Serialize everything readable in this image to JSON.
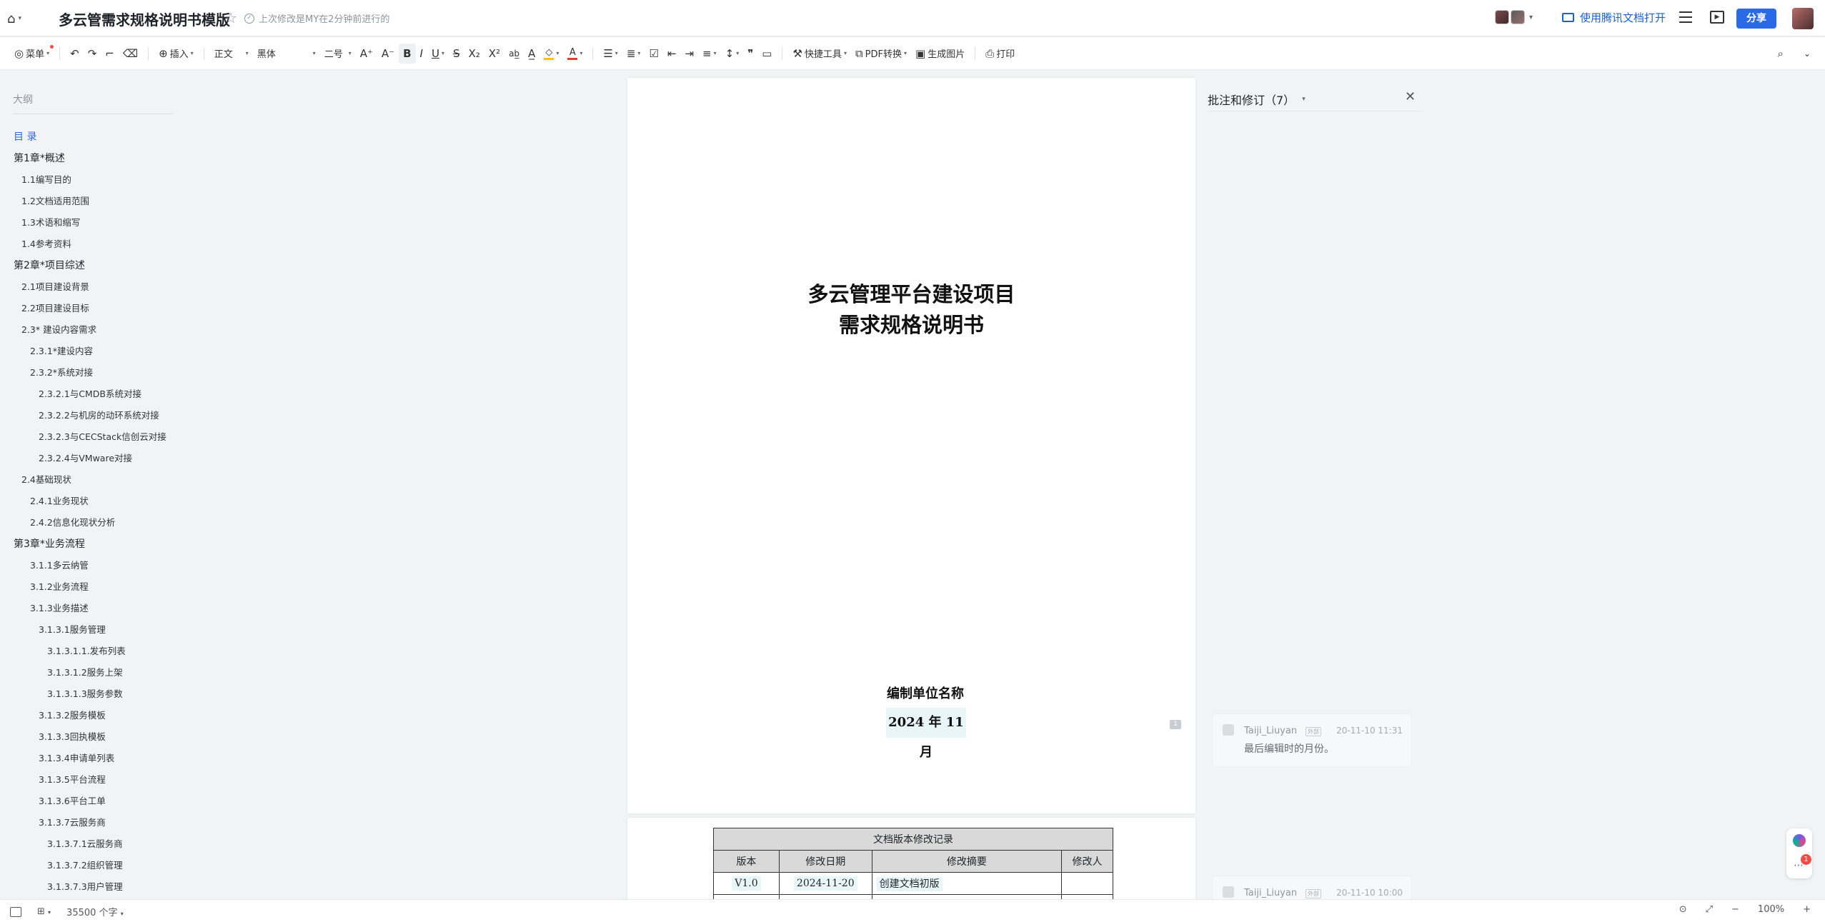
{
  "title_bar": {
    "doc_title": "多云管需求规格说明书模版",
    "last_edit": "上次修改是MY在2分钟前进行的",
    "open_app": "使用腾讯文档打开",
    "share": "分享"
  },
  "toolbar": {
    "menu": "菜单",
    "insert": "插入",
    "style": "正文",
    "font": "黑体",
    "size": "二号",
    "quick_tools": "快捷工具",
    "pdf": "PDF转换",
    "gen_image": "生成图片",
    "print": "打印",
    "font_color": "#e03e2d",
    "highlight_color": "#f7c600"
  },
  "outline": {
    "header": "大纲",
    "items": [
      {
        "text": "目 录",
        "level": 1,
        "active": true
      },
      {
        "text": "第1章*概述",
        "level": 1
      },
      {
        "text": "1.1编写目的",
        "level": 2
      },
      {
        "text": "1.2文档适用范围",
        "level": 2
      },
      {
        "text": "1.3术语和缩写",
        "level": 2
      },
      {
        "text": "1.4参考资料",
        "level": 2
      },
      {
        "text": "第2章*项目综述",
        "level": 1
      },
      {
        "text": "2.1项目建设背景",
        "level": 2
      },
      {
        "text": "2.2项目建设目标",
        "level": 2
      },
      {
        "text": "2.3*  建设内容需求",
        "level": 2
      },
      {
        "text": "2.3.1*建设内容",
        "level": 3
      },
      {
        "text": "2.3.2*系统对接",
        "level": 3
      },
      {
        "text": "2.3.2.1与CMDB系统对接",
        "level": 4
      },
      {
        "text": "2.3.2.2与机房的动环系统对接",
        "level": 4
      },
      {
        "text": "2.3.2.3与CECStack信创云对接",
        "level": 4
      },
      {
        "text": "2.3.2.4与VMware对接",
        "level": 4
      },
      {
        "text": "2.4基础现状",
        "level": 2
      },
      {
        "text": "2.4.1业务现状",
        "level": 3
      },
      {
        "text": "2.4.2信息化现状分析",
        "level": 3
      },
      {
        "text": "第3章*业务流程",
        "level": 1
      },
      {
        "text": "3.1.1多云纳管",
        "level": 3
      },
      {
        "text": "3.1.2业务流程",
        "level": 3
      },
      {
        "text": "3.1.3业务描述",
        "level": 3
      },
      {
        "text": "3.1.3.1服务管理",
        "level": 4
      },
      {
        "text": "3.1.3.1.1.发布列表",
        "level": 5
      },
      {
        "text": "3.1.3.1.2服务上架",
        "level": 5
      },
      {
        "text": "3.1.3.1.3服务参数",
        "level": 5
      },
      {
        "text": "3.1.3.2服务模板",
        "level": 4
      },
      {
        "text": "3.1.3.3回执模板",
        "level": 4
      },
      {
        "text": "3.1.3.4申请单列表",
        "level": 4
      },
      {
        "text": "3.1.3.5平台流程",
        "level": 4
      },
      {
        "text": "3.1.3.6平台工单",
        "level": 4
      },
      {
        "text": "3.1.3.7云服务商",
        "level": 4
      },
      {
        "text": "3.1.3.7.1云服务商",
        "level": 5
      },
      {
        "text": "3.1.3.7.2组织管理",
        "level": 5
      },
      {
        "text": "3.1.3.7.3用户管理",
        "level": 5
      }
    ]
  },
  "document": {
    "cover_title_line1": "多云管理平台建设项目",
    "cover_title_line2": "需求规格说明书",
    "org_name": "编制单位名称",
    "date": "2024 年 11 月",
    "comment_marker": "1",
    "revision_table": {
      "caption": "文档版本修改记录",
      "headers": [
        "版本",
        "修改日期",
        "修改摘要",
        "修改人"
      ],
      "rows": [
        [
          "V1.0",
          "2024-11-20",
          "创建文档初版",
          ""
        ]
      ]
    }
  },
  "comments": {
    "header": "批注和修订（7）",
    "cards": [
      {
        "author": "Taiji_Liuyan",
        "tag": "外部",
        "time": "20-11-10 11:31",
        "text": "最后编辑时的月份。"
      },
      {
        "author": "Taiji_Liuyan",
        "tag": "外部",
        "time": "20-11-10 10:00",
        "text": ""
      }
    ]
  },
  "floating": {
    "badge": "1"
  },
  "status_bar": {
    "word_count": "35500 个字",
    "zoom": "100%"
  }
}
